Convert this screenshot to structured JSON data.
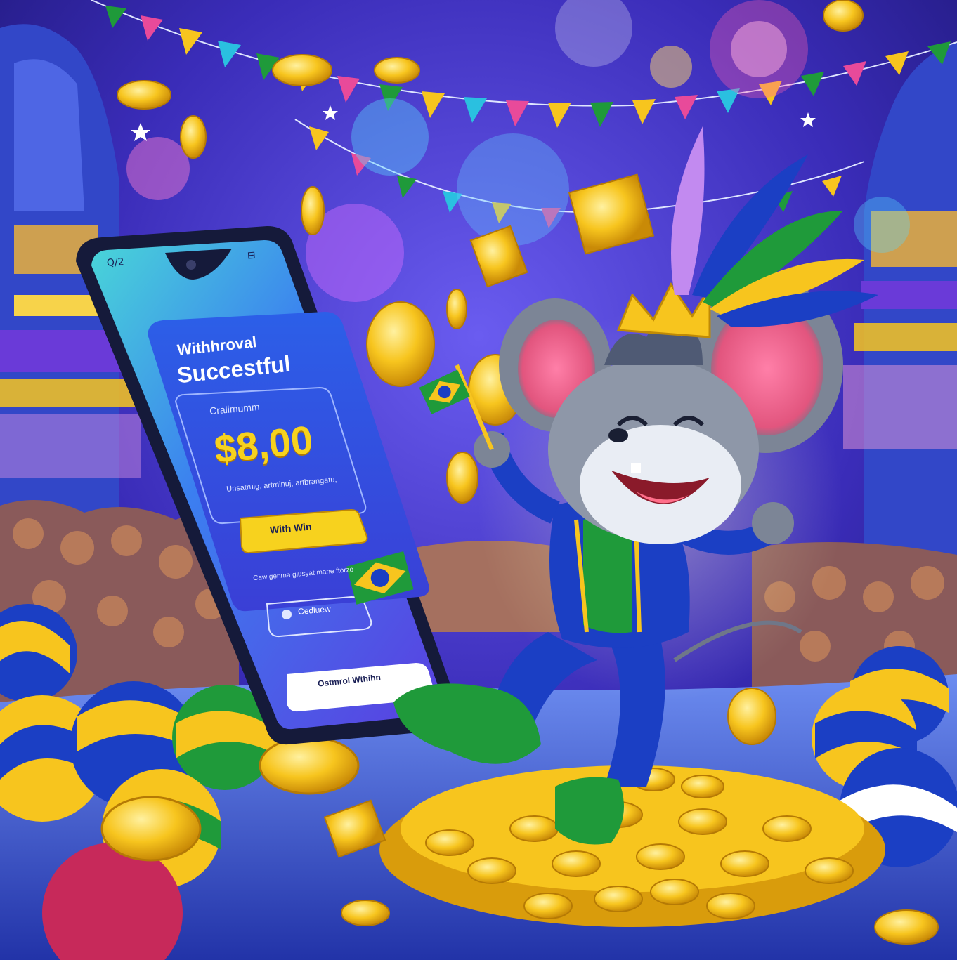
{
  "illustration": {
    "phone": {
      "status_left": "Q/2",
      "status_right": "⊟",
      "title_line1": "Withhroval",
      "title_line2": "Succestful",
      "subtitle": "Cralimumm",
      "amount": "$8,00",
      "caption": "Unsatrulg, artminuj, artbrangatu,",
      "button_label": "With Win",
      "note": "Caw genma glusyat mane ftorzo",
      "pill_label": "Cedluew",
      "footer_label": "Ostmrol Wthihn"
    },
    "palette": {
      "sky": "#2a1f9e",
      "sky_light": "#5b4fe0",
      "gold": "#f7c51e",
      "brazil_green": "#1f9a3a",
      "royal_blue": "#1b3fc4",
      "pink": "#e84a9a",
      "mouse_grey": "#7c8596"
    },
    "icons": [
      "fireworks",
      "bunting-flags",
      "gold-coins",
      "brazil-flag",
      "feather-headdress",
      "crown",
      "carnival-balls",
      "crowd"
    ]
  }
}
